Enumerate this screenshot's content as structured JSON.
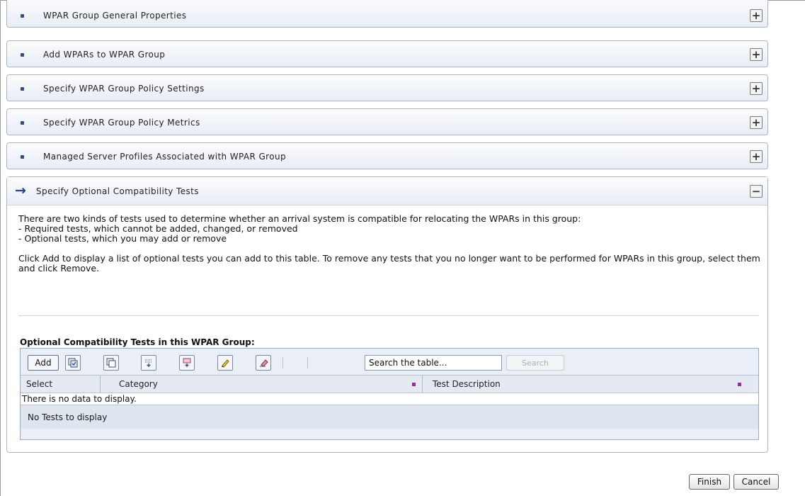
{
  "sections": [
    {
      "label": "WPAR Group General Properties",
      "toggle": "+"
    },
    {
      "label": "Add WPARs to WPAR Group",
      "toggle": "+"
    },
    {
      "label": "Specify WPAR Group Policy Settings",
      "toggle": "+"
    },
    {
      "label": "Specify WPAR Group Policy Metrics",
      "toggle": "+"
    },
    {
      "label": "Managed Server Profiles Associated with WPAR Group",
      "toggle": "+"
    }
  ],
  "active_section": {
    "label": "Specify Optional Compatibility Tests",
    "toggle": "−",
    "desc_line1": "There are two kinds of tests used to determine whether an arrival system is compatible for relocating the WPARs in this group:",
    "desc_line2": "- Required tests, which cannot be added, changed, or removed",
    "desc_line3": "- Optional tests, which you may add or remove",
    "desc_line4": "Click Add to display a list of optional tests you can add to this table. To remove any tests that you no longer want to be performed for WPARs in this group, select them and click Remove."
  },
  "table": {
    "title": "Optional Compatibility Tests in this WPAR Group:",
    "add_label": "Add",
    "search_placeholder": "Search the table...",
    "search_label": "Search",
    "columns": [
      "Select",
      "Category",
      "Test Description"
    ],
    "no_data": "There is no data to display.",
    "footer": "No Tests to display"
  },
  "buttons": {
    "finish": "Finish",
    "cancel": "Cancel"
  },
  "icons": [
    "select-all-icon",
    "deselect-all-icon",
    "expand-icon",
    "filter-icon",
    "edit-icon",
    "clear-icon"
  ]
}
